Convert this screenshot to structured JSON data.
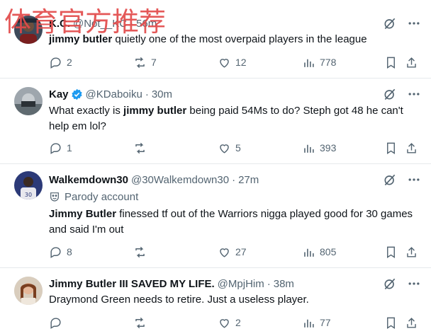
{
  "watermark": "体育官方推荐",
  "tweets": [
    {
      "name": "K.C.",
      "handle": "@Not__KC",
      "time": "56m",
      "text_bold": "jimmy butler",
      "text_rest": " quietly one of the most overpaid players in the league",
      "replies": "2",
      "reposts": "7",
      "likes": "12",
      "views": "778"
    },
    {
      "name": "Kay",
      "handle": "@KDaboiku",
      "time": "30m",
      "verified": true,
      "text_pre": "What exactly is ",
      "text_bold": "jimmy butler",
      "text_rest": " being paid 54Ms to do? Steph got 48 he can't help em lol?",
      "replies": "1",
      "reposts": "",
      "likes": "5",
      "views": "393"
    },
    {
      "name": "Walkemdown30",
      "handle": "@30Walkemdown30",
      "time": "27m",
      "parody_label": "Parody account",
      "text_bold": "Jimmy Butler",
      "text_rest": " finessed tf out of the Warriors nigga played good for 30 games and said I'm out",
      "replies": "8",
      "reposts": "",
      "likes": "27",
      "views": "805"
    },
    {
      "name": "Jimmy Butler III SAVED MY LIFE.",
      "handle": "@MpjHim",
      "time": "38m",
      "text_rest": "Draymond Green needs to retire. Just a useless player.",
      "replies": "",
      "reposts": "",
      "likes": "2",
      "views": "77"
    }
  ],
  "colors": {
    "text": "#0f1419",
    "muted": "#536471",
    "verified": "#1d9bf0",
    "divider": "#e6e9ec",
    "watermark": "#e24a4a"
  },
  "icons": [
    "reply-icon",
    "repost-icon",
    "like-icon",
    "views-icon",
    "bookmark-icon",
    "share-icon",
    "grok-icon",
    "more-icon",
    "verified-icon",
    "parody-icon"
  ]
}
